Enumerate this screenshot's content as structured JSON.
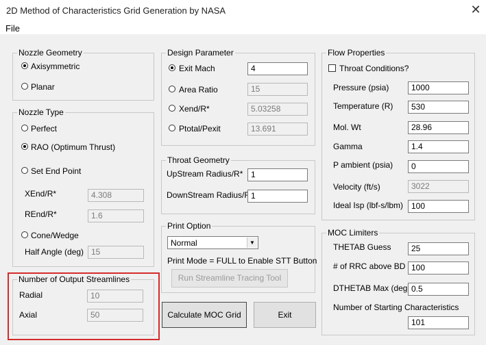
{
  "window": {
    "title": "2D Method of Characteristics Grid Generation by NASA",
    "close_glyph": "✕"
  },
  "menu": {
    "file": "File"
  },
  "nozzle_geometry": {
    "legend": "Nozzle Geometry",
    "axisymmetric": "Axisymmetric",
    "planar": "Planar",
    "selected": "Axisymmetric"
  },
  "nozzle_type": {
    "legend": "Nozzle Type",
    "perfect": "Perfect",
    "rao": "RAO (Optimum Thrust)",
    "set_end_point": "Set End Point",
    "xend_label": "XEnd/R*",
    "xend_value": "4.308",
    "rend_label": "REnd/R*",
    "rend_value": "1.6",
    "cone": "Cone/Wedge",
    "half_angle_label": "Half Angle (deg)",
    "half_angle_value": "15",
    "selected": "RAO (Optimum Thrust)"
  },
  "output_streamlines": {
    "legend": "Number of Output Streamlines",
    "radial_label": "Radial",
    "radial_value": "10",
    "axial_label": "Axial",
    "axial_value": "50",
    "highlight_color": "#d42a2a"
  },
  "design_parameter": {
    "legend": "Design Parameter",
    "exit_mach_label": "Exit Mach",
    "exit_mach_value": "4",
    "area_ratio_label": "Area Ratio",
    "area_ratio_value": "15",
    "xend_label": "Xend/R*",
    "xend_value": "5.03258",
    "ptotal_label": "Ptotal/Pexit",
    "ptotal_value": "13.691",
    "selected": "Exit Mach"
  },
  "throat_geometry": {
    "legend": "Throat Geometry",
    "upstream_label": "UpStream Radius/R*",
    "upstream_value": "1",
    "downstream_label": "DownStream Radius/R*",
    "downstream_value": "1"
  },
  "print_option": {
    "legend": "Print Option",
    "selected": "Normal",
    "hint": "Print Mode = FULL to Enable STT Button",
    "stt_button": "Run Streamline Tracing Tool"
  },
  "buttons": {
    "calculate": "Calculate MOC Grid",
    "exit": "Exit"
  },
  "flow_properties": {
    "legend": "Flow Properties",
    "throat_conditions": "Throat Conditions?",
    "throat_checked": false,
    "pressure_label": "Pressure (psia)",
    "pressure_value": "1000",
    "temperature_label": "Temperature (R)",
    "temperature_value": "530",
    "molwt_label": "Mol. Wt",
    "molwt_value": "28.96",
    "gamma_label": "Gamma",
    "gamma_value": "1.4",
    "pambient_label": "P ambient (psia)",
    "pambient_value": "0",
    "velocity_label": "Velocity (ft/s)",
    "velocity_value": "3022",
    "isp_label": "Ideal Isp (lbf-s/lbm)",
    "isp_value": "100"
  },
  "moc_limiters": {
    "legend": "MOC Limiters",
    "thetab_label": "THETAB Guess",
    "thetab_value": "25",
    "rrc_label": "# of RRC above BD",
    "rrc_value": "100",
    "dthetab_label": "DTHETAB Max (deg)",
    "dthetab_value": "0.5",
    "nsc_label": "Number of Starting Characteristics",
    "nsc_value": "101"
  }
}
